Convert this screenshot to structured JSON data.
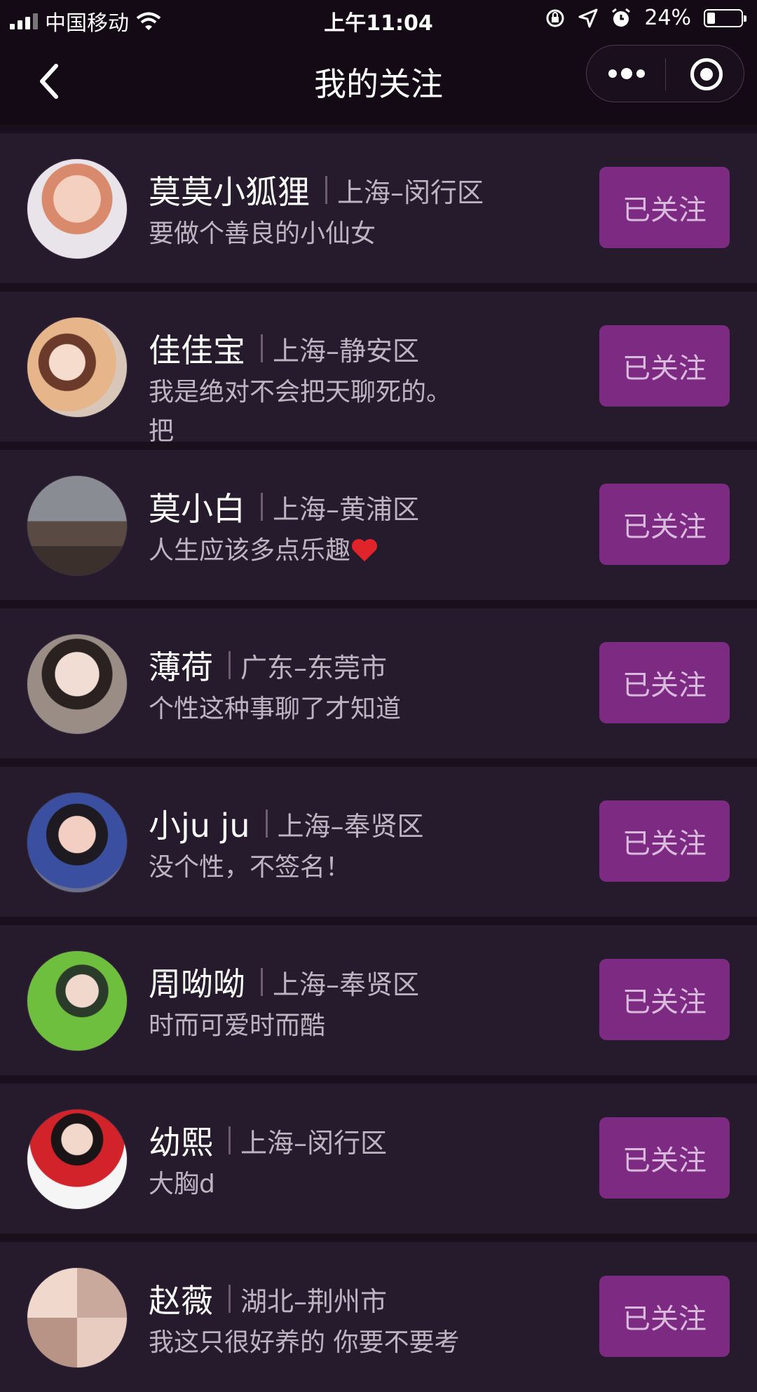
{
  "status_bar": {
    "carrier": "中国移动",
    "time": "上午11:04",
    "battery_percent": "24%",
    "battery_level": 0.24
  },
  "nav": {
    "title": "我的关注"
  },
  "colors": {
    "button_bg": "#7c2a82",
    "card_bg": "#261b2d",
    "page_bg": "#1a0f1c"
  },
  "follows": [
    {
      "name": "莫莫小狐狸",
      "location": "上海–闵行区",
      "signature": "要做个善良的小仙女",
      "button": "已关注"
    },
    {
      "name": "佳佳宝",
      "location": "上海–静安区",
      "signature": "我是绝对不会把天聊死的。把",
      "button": "已关注"
    },
    {
      "name": "莫小白",
      "location": "上海–黄浦区",
      "signature": "人生应该多点乐趣",
      "button": "已关注"
    },
    {
      "name": "薄荷",
      "location": "广东–东莞市",
      "signature": "个性这种事聊了才知道",
      "button": "已关注"
    },
    {
      "name": "小ju ju",
      "location": "上海–奉贤区",
      "signature": "没个性，不签名！",
      "button": "已关注"
    },
    {
      "name": "周呦呦",
      "location": "上海–奉贤区",
      "signature": "时而可爱时而酷",
      "button": "已关注"
    },
    {
      "name": "幼熙",
      "location": "上海–闵行区",
      "signature": "大胸d",
      "button": "已关注"
    },
    {
      "name": "赵薇",
      "location": "湖北–荆州市",
      "signature": "我这只很好养的 你要不要考",
      "button": "已关注"
    }
  ]
}
